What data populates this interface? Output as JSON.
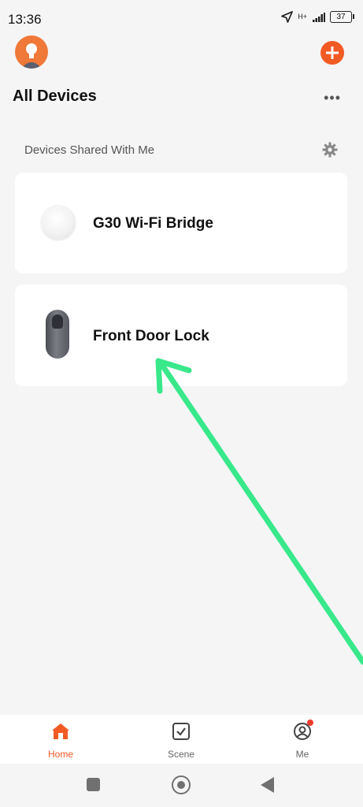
{
  "status_bar": {
    "time": "13:36",
    "network": "H+",
    "battery": "37"
  },
  "header": {
    "title": "All Devices",
    "more": "•••"
  },
  "section": {
    "title": "Devices Shared With Me"
  },
  "devices": [
    {
      "name": "G30 Wi-Fi Bridge",
      "icon": "wifi-bridge-image"
    },
    {
      "name": "Front Door Lock",
      "icon": "door-lock-image"
    }
  ],
  "tabs": [
    {
      "label": "Home",
      "icon": "home-icon",
      "active": true
    },
    {
      "label": "Scene",
      "icon": "scene-icon",
      "active": false
    },
    {
      "label": "Me",
      "icon": "profile-icon",
      "active": false
    }
  ],
  "colors": {
    "accent": "#f25a24",
    "annotation_arrow": "#38e88a",
    "background": "#f5f5f5"
  }
}
